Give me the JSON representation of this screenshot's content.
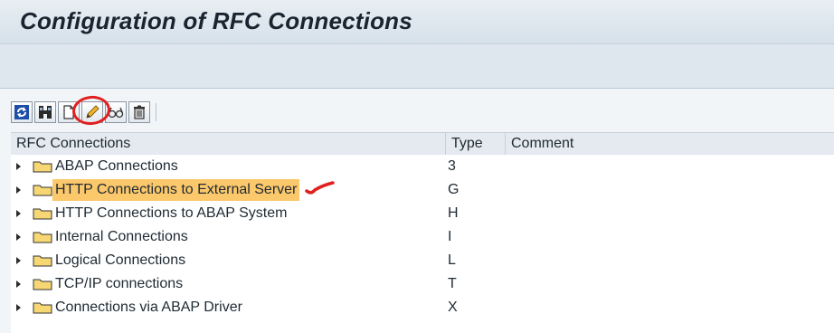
{
  "window": {
    "title": "Configuration of RFC Connections"
  },
  "tree_toolbar": {
    "buttons": [
      {
        "name": "refresh",
        "icon": "refresh-icon"
      },
      {
        "name": "find",
        "icon": "binoculars-icon"
      },
      {
        "name": "create",
        "icon": "new-document-icon"
      },
      {
        "name": "change",
        "icon": "pencil-icon"
      },
      {
        "name": "display",
        "icon": "glasses-icon"
      },
      {
        "name": "delete",
        "icon": "trash-icon"
      }
    ]
  },
  "tree": {
    "columns": [
      "RFC Connections",
      "Type",
      "Comment"
    ],
    "rows": [
      {
        "label": "ABAP Connections",
        "type": "3",
        "comment": ""
      },
      {
        "label": "HTTP Connections to External Server",
        "type": "G",
        "comment": "",
        "selected": true
      },
      {
        "label": "HTTP Connections to ABAP System",
        "type": "H",
        "comment": ""
      },
      {
        "label": "Internal Connections",
        "type": "I",
        "comment": ""
      },
      {
        "label": "Logical Connections",
        "type": "L",
        "comment": ""
      },
      {
        "label": "TCP/IP connections",
        "type": "T",
        "comment": ""
      },
      {
        "label": "Connections via ABAP Driver",
        "type": "X",
        "comment": ""
      }
    ]
  },
  "colors": {
    "selection": "#fbc86b",
    "annotation": "#e02020",
    "folder": "#f7d774"
  }
}
